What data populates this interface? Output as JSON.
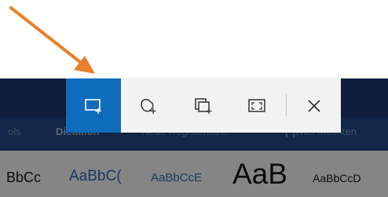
{
  "annotation": {
    "arrow_color": "#e8802b",
    "icon": "arrow-down-right-icon"
  },
  "word": {
    "tabs": {
      "view_fragment": "ols",
      "dictation": "Dictation",
      "new_tab": "Neue Registerkarte",
      "help": "Was möchten"
    },
    "style_samples": [
      "BbCc",
      "AaBbC(",
      "AaBbCcE",
      "AaB",
      "AaBbCcD"
    ],
    "colors": {
      "ribbon_top": "#1d3b75",
      "ribbon_tabs": "#244a8c",
      "style_accent": "#2e6dc1"
    }
  },
  "snip_toolbar": {
    "accent_color": "#0f6cbd",
    "background": "#f2f2f2",
    "buttons": [
      {
        "name": "rectangular-snip",
        "icon": "rectangle-snip-icon",
        "active": true
      },
      {
        "name": "freeform-snip",
        "icon": "freeform-snip-icon",
        "active": false
      },
      {
        "name": "window-snip",
        "icon": "window-snip-icon",
        "active": false
      },
      {
        "name": "fullscreen-snip",
        "icon": "fullscreen-snip-icon",
        "active": false
      },
      {
        "name": "close",
        "icon": "close-icon",
        "active": false
      }
    ]
  }
}
